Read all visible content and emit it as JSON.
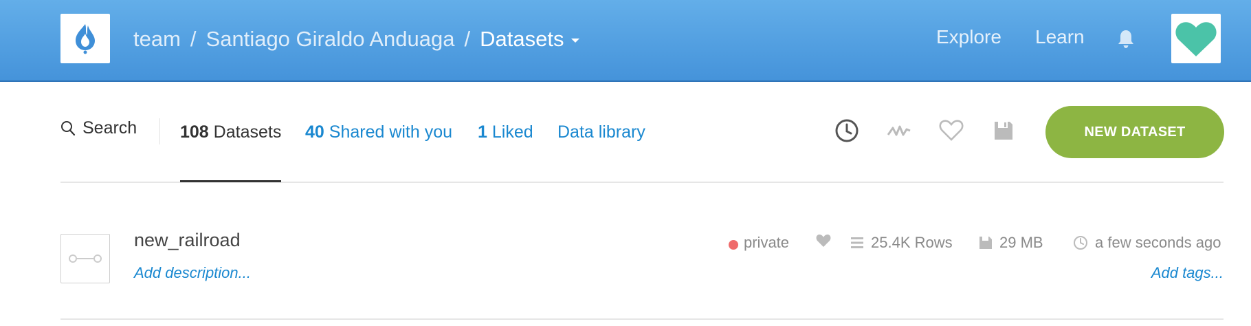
{
  "header": {
    "breadcrumb": [
      "team",
      "Santiago Giraldo Anduaga",
      "Datasets"
    ],
    "separator": "/",
    "explore_label": "Explore",
    "learn_label": "Learn",
    "colors": {
      "bar_top": "#63aee9",
      "bar_bottom": "#4593da",
      "logo": "#3f8fd8",
      "avatar_heart": "#4bc3a8"
    }
  },
  "toolbar": {
    "search_label": "Search",
    "tabs": [
      {
        "count": "108",
        "label": "Datasets",
        "active": true
      },
      {
        "count": "40",
        "label": "Shared with you",
        "active": false
      },
      {
        "count": "1",
        "label": "Liked",
        "active": false
      },
      {
        "count": "",
        "label": "Data library",
        "active": false
      }
    ],
    "icons": [
      "clock-icon",
      "activity-icon",
      "heart-icon",
      "save-icon"
    ],
    "new_dataset_label": "NEW DATASET",
    "colors": {
      "accent": "#8db543",
      "link": "#1a88d0"
    }
  },
  "datasets": [
    {
      "name": "new_railroad",
      "description_placeholder": "Add description...",
      "visibility": "private",
      "visibility_color": "#ef6b6b",
      "rows": "25.4K Rows",
      "size": "29 MB",
      "updated": "a few seconds ago",
      "tags_placeholder": "Add tags..."
    }
  ]
}
